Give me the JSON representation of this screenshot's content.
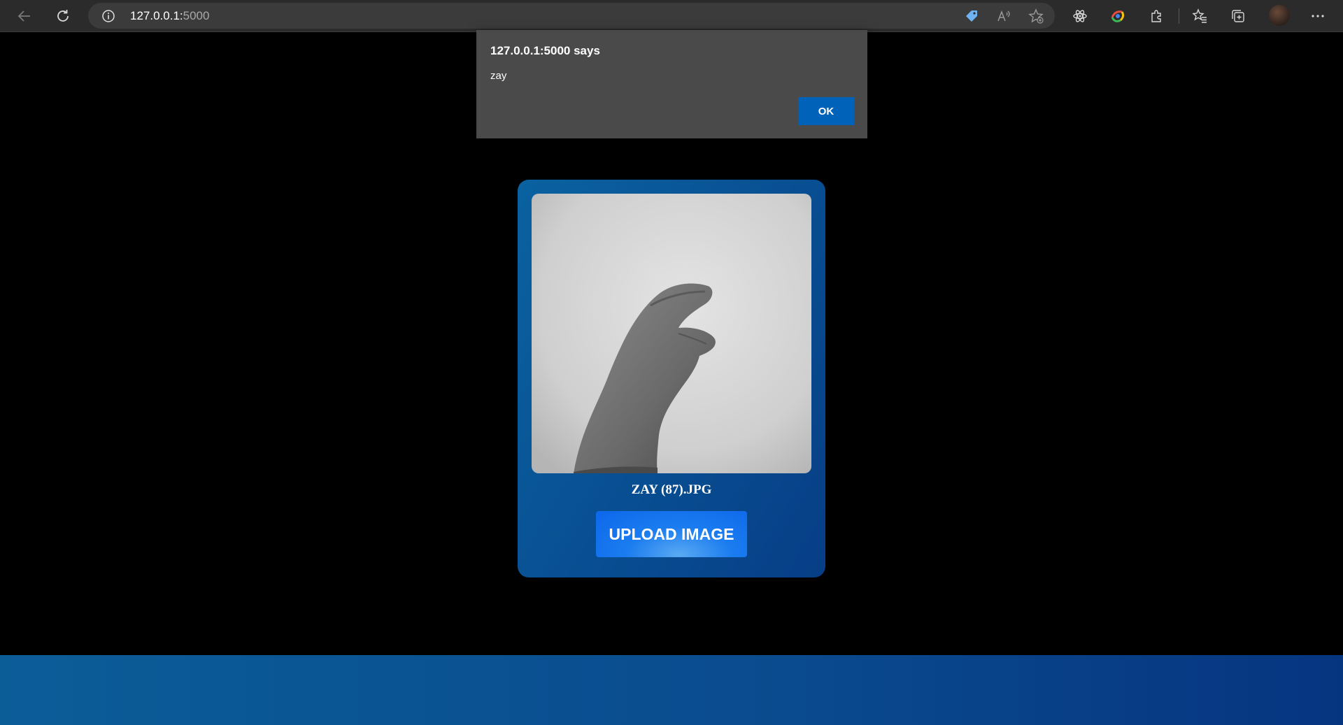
{
  "browser": {
    "url_host": "127.0.0.1:",
    "url_port": "5000",
    "icons": [
      "back-arrow-icon",
      "refresh-icon",
      "site-info-icon",
      "shopping-tag-icon",
      "read-aloud-icon",
      "add-favorite-icon",
      "copilot-atom-icon",
      "browser-essentials-icon",
      "extensions-icon",
      "favorites-icon",
      "collections-icon",
      "profile-avatar",
      "more-menu-icon"
    ]
  },
  "alert": {
    "title": "127.0.0.1:5000 says",
    "message": "zay",
    "ok_label": "OK"
  },
  "card": {
    "image_alt": "Grayscale photo of a hand sign",
    "filename": "ZAY (87).JPG",
    "upload_label": "UPLOAD IMAGE"
  },
  "colors": {
    "page_bg": "#000000",
    "card_gradient_start": "#0a62a0",
    "card_gradient_end": "#073e86",
    "button_blue": "#1b7cf0",
    "dialog_bg": "#4a4a4a",
    "ok_button": "#0062b8"
  }
}
